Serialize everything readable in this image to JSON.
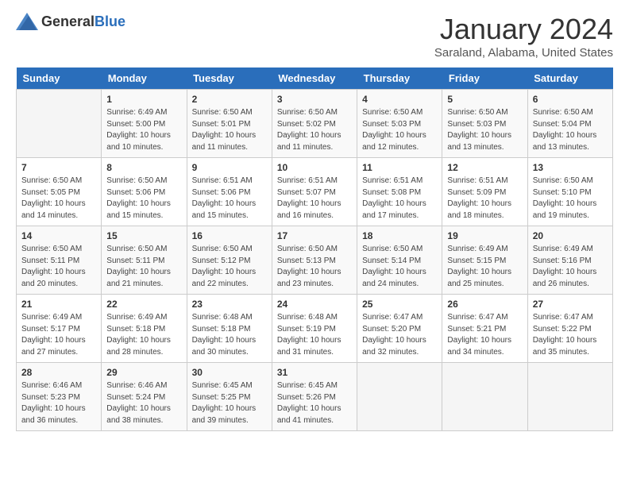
{
  "header": {
    "logo_general": "General",
    "logo_blue": "Blue",
    "month": "January 2024",
    "location": "Saraland, Alabama, United States"
  },
  "days_of_week": [
    "Sunday",
    "Monday",
    "Tuesday",
    "Wednesday",
    "Thursday",
    "Friday",
    "Saturday"
  ],
  "weeks": [
    [
      {
        "day": "",
        "sunrise": "",
        "sunset": "",
        "daylight": ""
      },
      {
        "day": "1",
        "sunrise": "Sunrise: 6:49 AM",
        "sunset": "Sunset: 5:00 PM",
        "daylight": "Daylight: 10 hours and 10 minutes."
      },
      {
        "day": "2",
        "sunrise": "Sunrise: 6:50 AM",
        "sunset": "Sunset: 5:01 PM",
        "daylight": "Daylight: 10 hours and 11 minutes."
      },
      {
        "day": "3",
        "sunrise": "Sunrise: 6:50 AM",
        "sunset": "Sunset: 5:02 PM",
        "daylight": "Daylight: 10 hours and 11 minutes."
      },
      {
        "day": "4",
        "sunrise": "Sunrise: 6:50 AM",
        "sunset": "Sunset: 5:03 PM",
        "daylight": "Daylight: 10 hours and 12 minutes."
      },
      {
        "day": "5",
        "sunrise": "Sunrise: 6:50 AM",
        "sunset": "Sunset: 5:03 PM",
        "daylight": "Daylight: 10 hours and 13 minutes."
      },
      {
        "day": "6",
        "sunrise": "Sunrise: 6:50 AM",
        "sunset": "Sunset: 5:04 PM",
        "daylight": "Daylight: 10 hours and 13 minutes."
      }
    ],
    [
      {
        "day": "7",
        "sunrise": "Sunrise: 6:50 AM",
        "sunset": "Sunset: 5:05 PM",
        "daylight": "Daylight: 10 hours and 14 minutes."
      },
      {
        "day": "8",
        "sunrise": "Sunrise: 6:50 AM",
        "sunset": "Sunset: 5:06 PM",
        "daylight": "Daylight: 10 hours and 15 minutes."
      },
      {
        "day": "9",
        "sunrise": "Sunrise: 6:51 AM",
        "sunset": "Sunset: 5:06 PM",
        "daylight": "Daylight: 10 hours and 15 minutes."
      },
      {
        "day": "10",
        "sunrise": "Sunrise: 6:51 AM",
        "sunset": "Sunset: 5:07 PM",
        "daylight": "Daylight: 10 hours and 16 minutes."
      },
      {
        "day": "11",
        "sunrise": "Sunrise: 6:51 AM",
        "sunset": "Sunset: 5:08 PM",
        "daylight": "Daylight: 10 hours and 17 minutes."
      },
      {
        "day": "12",
        "sunrise": "Sunrise: 6:51 AM",
        "sunset": "Sunset: 5:09 PM",
        "daylight": "Daylight: 10 hours and 18 minutes."
      },
      {
        "day": "13",
        "sunrise": "Sunrise: 6:50 AM",
        "sunset": "Sunset: 5:10 PM",
        "daylight": "Daylight: 10 hours and 19 minutes."
      }
    ],
    [
      {
        "day": "14",
        "sunrise": "Sunrise: 6:50 AM",
        "sunset": "Sunset: 5:11 PM",
        "daylight": "Daylight: 10 hours and 20 minutes."
      },
      {
        "day": "15",
        "sunrise": "Sunrise: 6:50 AM",
        "sunset": "Sunset: 5:11 PM",
        "daylight": "Daylight: 10 hours and 21 minutes."
      },
      {
        "day": "16",
        "sunrise": "Sunrise: 6:50 AM",
        "sunset": "Sunset: 5:12 PM",
        "daylight": "Daylight: 10 hours and 22 minutes."
      },
      {
        "day": "17",
        "sunrise": "Sunrise: 6:50 AM",
        "sunset": "Sunset: 5:13 PM",
        "daylight": "Daylight: 10 hours and 23 minutes."
      },
      {
        "day": "18",
        "sunrise": "Sunrise: 6:50 AM",
        "sunset": "Sunset: 5:14 PM",
        "daylight": "Daylight: 10 hours and 24 minutes."
      },
      {
        "day": "19",
        "sunrise": "Sunrise: 6:49 AM",
        "sunset": "Sunset: 5:15 PM",
        "daylight": "Daylight: 10 hours and 25 minutes."
      },
      {
        "day": "20",
        "sunrise": "Sunrise: 6:49 AM",
        "sunset": "Sunset: 5:16 PM",
        "daylight": "Daylight: 10 hours and 26 minutes."
      }
    ],
    [
      {
        "day": "21",
        "sunrise": "Sunrise: 6:49 AM",
        "sunset": "Sunset: 5:17 PM",
        "daylight": "Daylight: 10 hours and 27 minutes."
      },
      {
        "day": "22",
        "sunrise": "Sunrise: 6:49 AM",
        "sunset": "Sunset: 5:18 PM",
        "daylight": "Daylight: 10 hours and 28 minutes."
      },
      {
        "day": "23",
        "sunrise": "Sunrise: 6:48 AM",
        "sunset": "Sunset: 5:18 PM",
        "daylight": "Daylight: 10 hours and 30 minutes."
      },
      {
        "day": "24",
        "sunrise": "Sunrise: 6:48 AM",
        "sunset": "Sunset: 5:19 PM",
        "daylight": "Daylight: 10 hours and 31 minutes."
      },
      {
        "day": "25",
        "sunrise": "Sunrise: 6:47 AM",
        "sunset": "Sunset: 5:20 PM",
        "daylight": "Daylight: 10 hours and 32 minutes."
      },
      {
        "day": "26",
        "sunrise": "Sunrise: 6:47 AM",
        "sunset": "Sunset: 5:21 PM",
        "daylight": "Daylight: 10 hours and 34 minutes."
      },
      {
        "day": "27",
        "sunrise": "Sunrise: 6:47 AM",
        "sunset": "Sunset: 5:22 PM",
        "daylight": "Daylight: 10 hours and 35 minutes."
      }
    ],
    [
      {
        "day": "28",
        "sunrise": "Sunrise: 6:46 AM",
        "sunset": "Sunset: 5:23 PM",
        "daylight": "Daylight: 10 hours and 36 minutes."
      },
      {
        "day": "29",
        "sunrise": "Sunrise: 6:46 AM",
        "sunset": "Sunset: 5:24 PM",
        "daylight": "Daylight: 10 hours and 38 minutes."
      },
      {
        "day": "30",
        "sunrise": "Sunrise: 6:45 AM",
        "sunset": "Sunset: 5:25 PM",
        "daylight": "Daylight: 10 hours and 39 minutes."
      },
      {
        "day": "31",
        "sunrise": "Sunrise: 6:45 AM",
        "sunset": "Sunset: 5:26 PM",
        "daylight": "Daylight: 10 hours and 41 minutes."
      },
      {
        "day": "",
        "sunrise": "",
        "sunset": "",
        "daylight": ""
      },
      {
        "day": "",
        "sunrise": "",
        "sunset": "",
        "daylight": ""
      },
      {
        "day": "",
        "sunrise": "",
        "sunset": "",
        "daylight": ""
      }
    ]
  ]
}
